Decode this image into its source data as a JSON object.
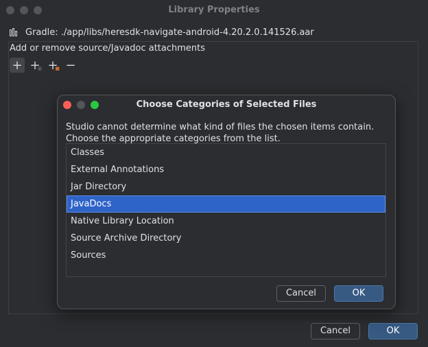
{
  "window": {
    "title": "Library Properties",
    "library_line": "Gradle: ./app/libs/heresdk-navigate-android-4.20.2.0.141526.aar",
    "section_label": "Add or remove source/Javadoc attachments",
    "cancel_label": "Cancel",
    "ok_label": "OK",
    "toolbar": [
      "add-icon",
      "add-attachment-icon",
      "add-file-icon",
      "remove-icon"
    ]
  },
  "dialog": {
    "title": "Choose Categories of Selected Files",
    "message_line1": "Studio cannot determine what kind of files the chosen items contain.",
    "message_line2": "Choose the appropriate categories from the list.",
    "items": [
      {
        "label": "Classes",
        "selected": false
      },
      {
        "label": "External Annotations",
        "selected": false
      },
      {
        "label": "Jar Directory",
        "selected": false
      },
      {
        "label": "JavaDocs",
        "selected": true
      },
      {
        "label": "Native Library Location",
        "selected": false
      },
      {
        "label": "Source Archive Directory",
        "selected": false
      },
      {
        "label": "Sources",
        "selected": false
      }
    ],
    "cancel_label": "Cancel",
    "ok_label": "OK",
    "traffic_colors": [
      "#ff5f57",
      "#555659",
      "#28c840"
    ]
  },
  "colors": {
    "background": "#2b2d30",
    "selection": "#2e63c8",
    "ok_button": "#375a83"
  }
}
